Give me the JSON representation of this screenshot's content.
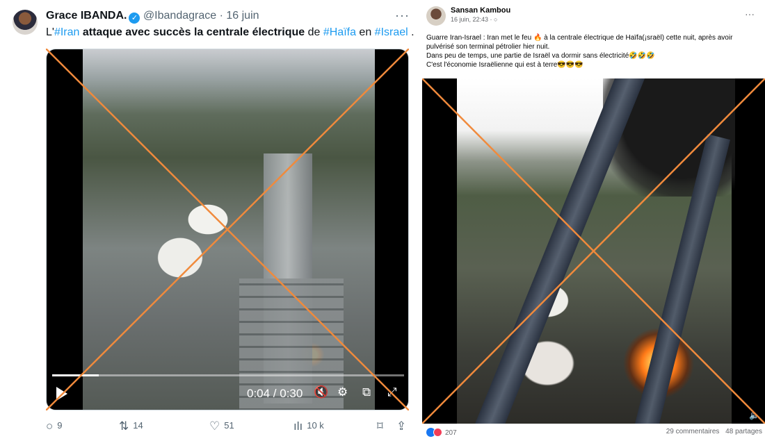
{
  "twitter_post": {
    "author_name": "Grace IBANDA.",
    "verified_badge": "✓",
    "handle": "@Ibandagrace",
    "separator": "·",
    "date": "16 juin",
    "more_menu": "···",
    "text": {
      "part1": "L'",
      "tag_iran": "#Iran",
      "part2": " attaque avec succès la centrale électrique",
      "part3": " de ",
      "tag_haifa": "#Haïfa",
      "part4": " en ",
      "tag_israel": "#Israel",
      "part5": " ."
    },
    "video": {
      "current_time": "0:04",
      "duration": "0:30",
      "time_display": "0:04 / 0:30",
      "progress": 0.133,
      "icons": [
        "play-icon",
        "mute-icon",
        "settings-icon",
        "picture-in-picture-icon",
        "fullscreen-icon"
      ]
    },
    "actions": {
      "replies": "9",
      "reposts": "14",
      "likes": "51",
      "views": "10 k"
    }
  },
  "facebook_post": {
    "author_name": "Sansan Kambou",
    "meta": "16 juin, 22:43 · ○",
    "more_menu": "···",
    "lines": [
      "Guarre Iran-Israel : Iran met le feu 🔥 à la centrale électrique de Haïfa(¡sraël) cette nuit, après avoir",
      "pulvérisé son terminal pétrolier hier nuit.",
      "Dans peu de temps, une partie de Israël va dormir sans électricité🤣🤣🤣",
      "C'est l'économie Israëlienne qui est à terre😎😎😎"
    ],
    "reactions_count": "207",
    "comments": "29 commentaires",
    "shares": "48 partages",
    "volume_icon": "🔈"
  },
  "colors": {
    "x_link": "#1d9bf0",
    "x_muted": "#536471",
    "fb_like": "#1877f2",
    "fb_love": "#f33e58",
    "cross": "#f08a3c"
  }
}
